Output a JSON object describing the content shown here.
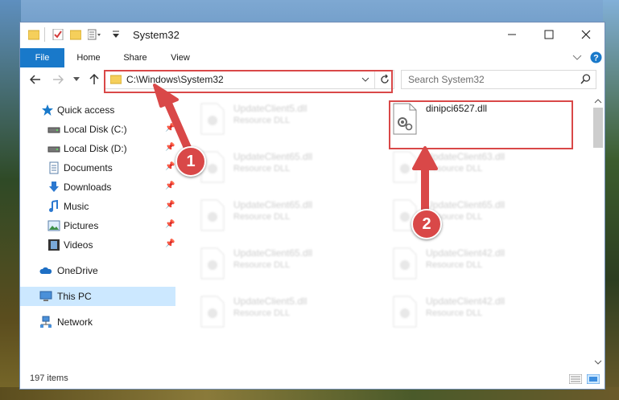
{
  "window": {
    "title": "System32",
    "minimize_icon": "minimize-icon",
    "maximize_icon": "maximize-icon",
    "close_icon": "close-icon"
  },
  "ribbon": {
    "tabs": [
      {
        "label": "File"
      },
      {
        "label": "Home"
      },
      {
        "label": "Share"
      },
      {
        "label": "View"
      }
    ]
  },
  "address": {
    "path": "C:\\Windows\\System32",
    "search_placeholder": "Search System32"
  },
  "nav_pane": {
    "items": [
      {
        "label": "Quick access",
        "icon": "star-icon"
      },
      {
        "label": "Local Disk (C:)",
        "icon": "drive-icon"
      },
      {
        "label": "Local Disk (D:)",
        "icon": "drive-icon"
      },
      {
        "label": "Documents",
        "icon": "documents-icon"
      },
      {
        "label": "Downloads",
        "icon": "downloads-icon"
      },
      {
        "label": "Music",
        "icon": "music-icon"
      },
      {
        "label": "Pictures",
        "icon": "pictures-icon"
      },
      {
        "label": "Videos",
        "icon": "videos-icon"
      },
      {
        "label": "OneDrive",
        "icon": "onedrive-icon"
      },
      {
        "label": "This PC",
        "icon": "computer-icon",
        "selected": true
      },
      {
        "label": "Network",
        "icon": "network-icon"
      }
    ]
  },
  "files": [
    {
      "name": "UpdateClient5.dll",
      "type": "Resource DLL"
    },
    {
      "name": "dinipci6527.dll",
      "type": ""
    },
    {
      "name": "UpdateClient65.dll",
      "type": "Resource DLL"
    },
    {
      "name": "UpdateClient63.dll",
      "type": "Resource DLL"
    },
    {
      "name": "UpdateClient65.dll",
      "type": "Resource DLL"
    },
    {
      "name": "UpdateClient65.dll",
      "type": "Resource DLL"
    },
    {
      "name": "UpdateClient65.dll",
      "type": "Resource DLL"
    },
    {
      "name": "UpdateClient42.dll",
      "type": "Resource DLL"
    },
    {
      "name": "UpdateClient5.dll",
      "type": "Resource DLL"
    },
    {
      "name": "UpdateClient42.dll",
      "type": "Resource DLL"
    }
  ],
  "status": {
    "item_count": "197 items"
  },
  "annotations": {
    "badge1": "1",
    "badge2": "2",
    "color": "#d94848"
  }
}
